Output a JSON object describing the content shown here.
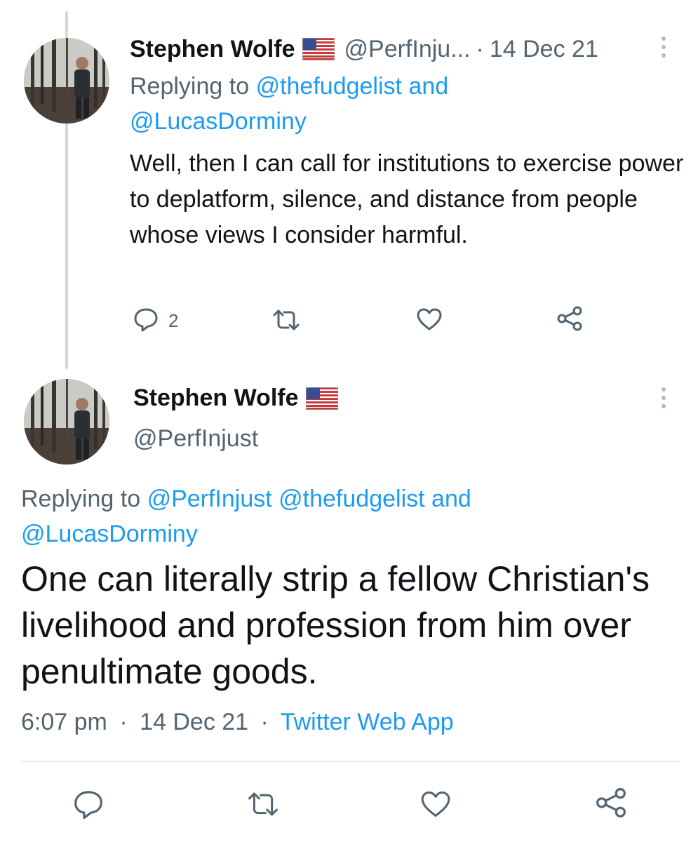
{
  "tweet1": {
    "author_name": "Stephen Wolfe",
    "author_handle": "@PerfInju...",
    "separator": "·",
    "date": "14 Dec 21",
    "replying_prefix": "Replying to",
    "replying_user1": "@thefudgelist",
    "replying_and": "and",
    "replying_user2": "@LucasDorminy",
    "text": "Well, then I can call for institutions to exercise power to deplatform, silence, and distance from people whose views I consider harmful.",
    "reply_count": "2"
  },
  "tweet2": {
    "author_name": "Stephen Wolfe",
    "author_handle": "@PerfInjust",
    "replying_prefix": "Replying to",
    "replying_user1": "@PerfInjust",
    "replying_user2": "@thefudgelist",
    "replying_and": "and",
    "replying_user3": "@LucasDorminy",
    "text": "One can literally strip a fellow Christian's livelihood and profession from him over penultimate goods.",
    "time": "6:07 pm",
    "separator": "·",
    "date": "14 Dec 21",
    "source": "Twitter Web App"
  },
  "colors": {
    "link": "#1d9bf0",
    "secondary": "#536471",
    "primary_text": "#0f1419",
    "thread_line": "#cfd9de"
  },
  "icons": [
    "reply-icon",
    "retweet-icon",
    "like-icon",
    "share-icon",
    "more-icon",
    "us-flag-icon"
  ]
}
